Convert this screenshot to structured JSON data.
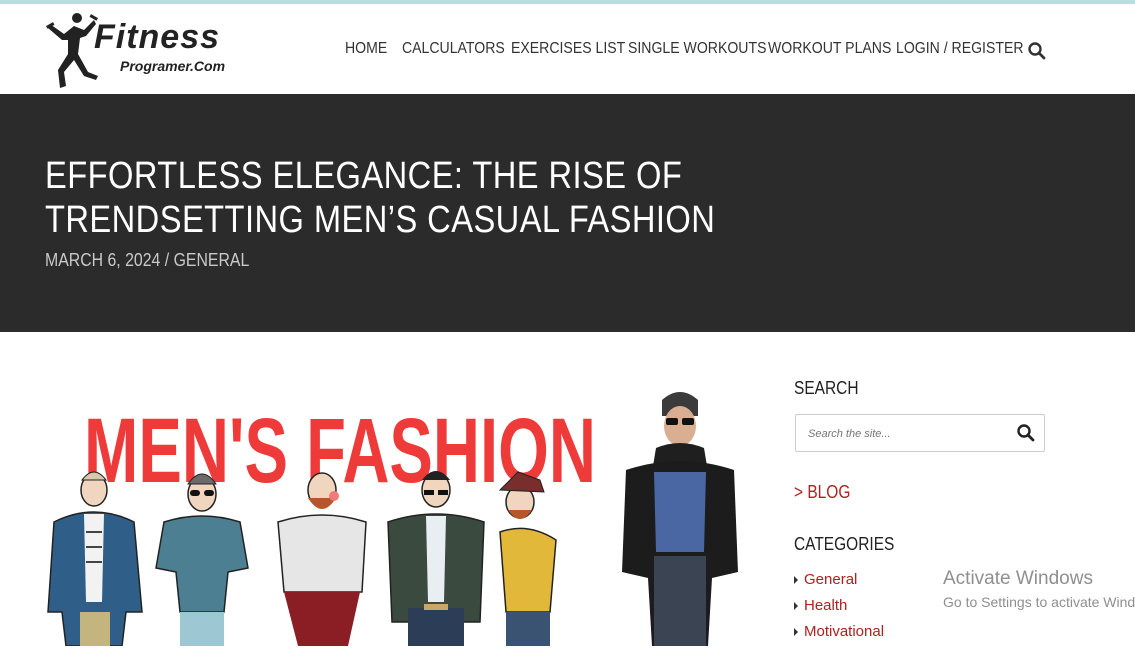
{
  "site": {
    "logo_title": "Fitness",
    "logo_subtitle": "Programer.Com"
  },
  "nav": {
    "items": [
      {
        "label": "HOME",
        "name": "nav-home"
      },
      {
        "label": "CALCULATORS",
        "name": "nav-calculators"
      },
      {
        "label": "EXERCISES LIST",
        "name": "nav-exercises-list"
      },
      {
        "label": "SINGLE WORKOUTS",
        "name": "nav-single-workouts"
      },
      {
        "label": "WORKOUT PLANS",
        "name": "nav-workout-plans"
      },
      {
        "label": "LOGIN / REGISTER",
        "name": "nav-login-register"
      }
    ],
    "search_icon": "search-icon"
  },
  "post": {
    "title": "EFFORTLESS ELEGANCE: THE RISE OF TRENDSETTING MEN’S CASUAL FASHION",
    "date": "MARCH 6, 2024",
    "separator": "/",
    "category": "GENERAL",
    "featured_image_text": "MEN'S FASHION"
  },
  "sidebar": {
    "search_heading": "SEARCH",
    "search_placeholder": "Search the site...",
    "blog_link": "> BLOG",
    "categories_heading": "CATEGORIES",
    "categories": [
      "General",
      "Health",
      "Motivational"
    ]
  },
  "os_overlay": {
    "line1": "Activate Windows",
    "line2": "Go to Settings to activate Windows."
  },
  "colors": {
    "accent": "#b0201e",
    "hero_bg": "#2b2b2b",
    "image_title": "#ef3a3a"
  }
}
